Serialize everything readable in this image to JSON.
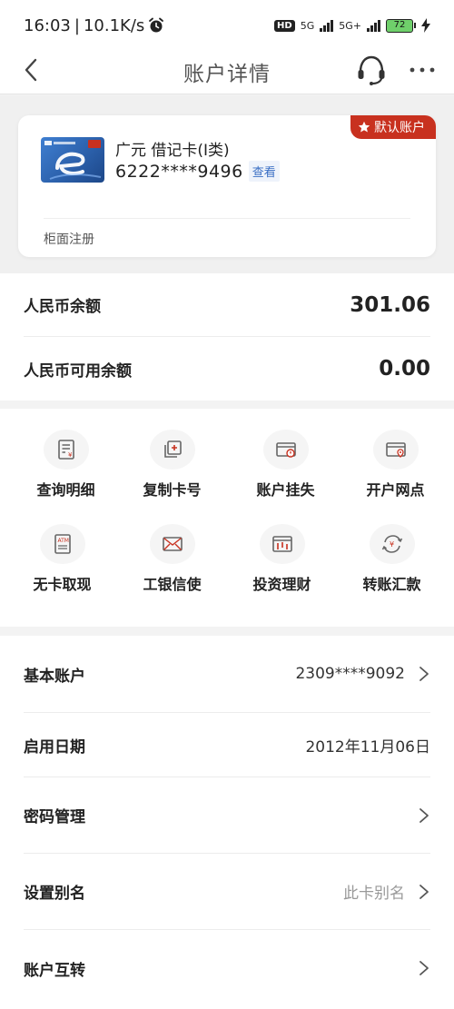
{
  "status_bar": {
    "time": "16:03",
    "net_speed": "10.1K/s",
    "hd": "HD",
    "net1": "5G",
    "net2": "5G+",
    "battery": "72"
  },
  "nav": {
    "title": "账户详情"
  },
  "card": {
    "name": "广元 借记卡(I类)",
    "number": "6222****9496",
    "view_label": "查看",
    "default_badge": "默认账户",
    "status": "柜面注册"
  },
  "balances": [
    {
      "label": "人民币余额",
      "value": "301.06"
    },
    {
      "label": "人民币可用余额",
      "value": "0.00"
    }
  ],
  "functions": [
    {
      "label": "查询明细",
      "icon": "statement-icon"
    },
    {
      "label": "复制卡号",
      "icon": "copy-card-icon"
    },
    {
      "label": "账户挂失",
      "icon": "report-loss-icon"
    },
    {
      "label": "开户网点",
      "icon": "branch-location-icon"
    },
    {
      "label": "无卡取现",
      "icon": "atm-icon"
    },
    {
      "label": "工银信使",
      "icon": "message-icon"
    },
    {
      "label": "投资理财",
      "icon": "invest-icon"
    },
    {
      "label": "转账汇款",
      "icon": "transfer-icon"
    }
  ],
  "settings": [
    {
      "label": "基本账户",
      "value": "2309****9092",
      "chevron": true
    },
    {
      "label": "启用日期",
      "value": "2012年11月06日",
      "chevron": false
    },
    {
      "label": "密码管理",
      "value": "",
      "chevron": true
    },
    {
      "label": "设置别名",
      "value": "此卡别名",
      "chevron": true
    },
    {
      "label": "账户互转",
      "value": "",
      "chevron": true
    }
  ],
  "colors": {
    "accent_red": "#c8311f",
    "link_blue": "#3a6fc4",
    "battery_green": "#6fd06b"
  }
}
